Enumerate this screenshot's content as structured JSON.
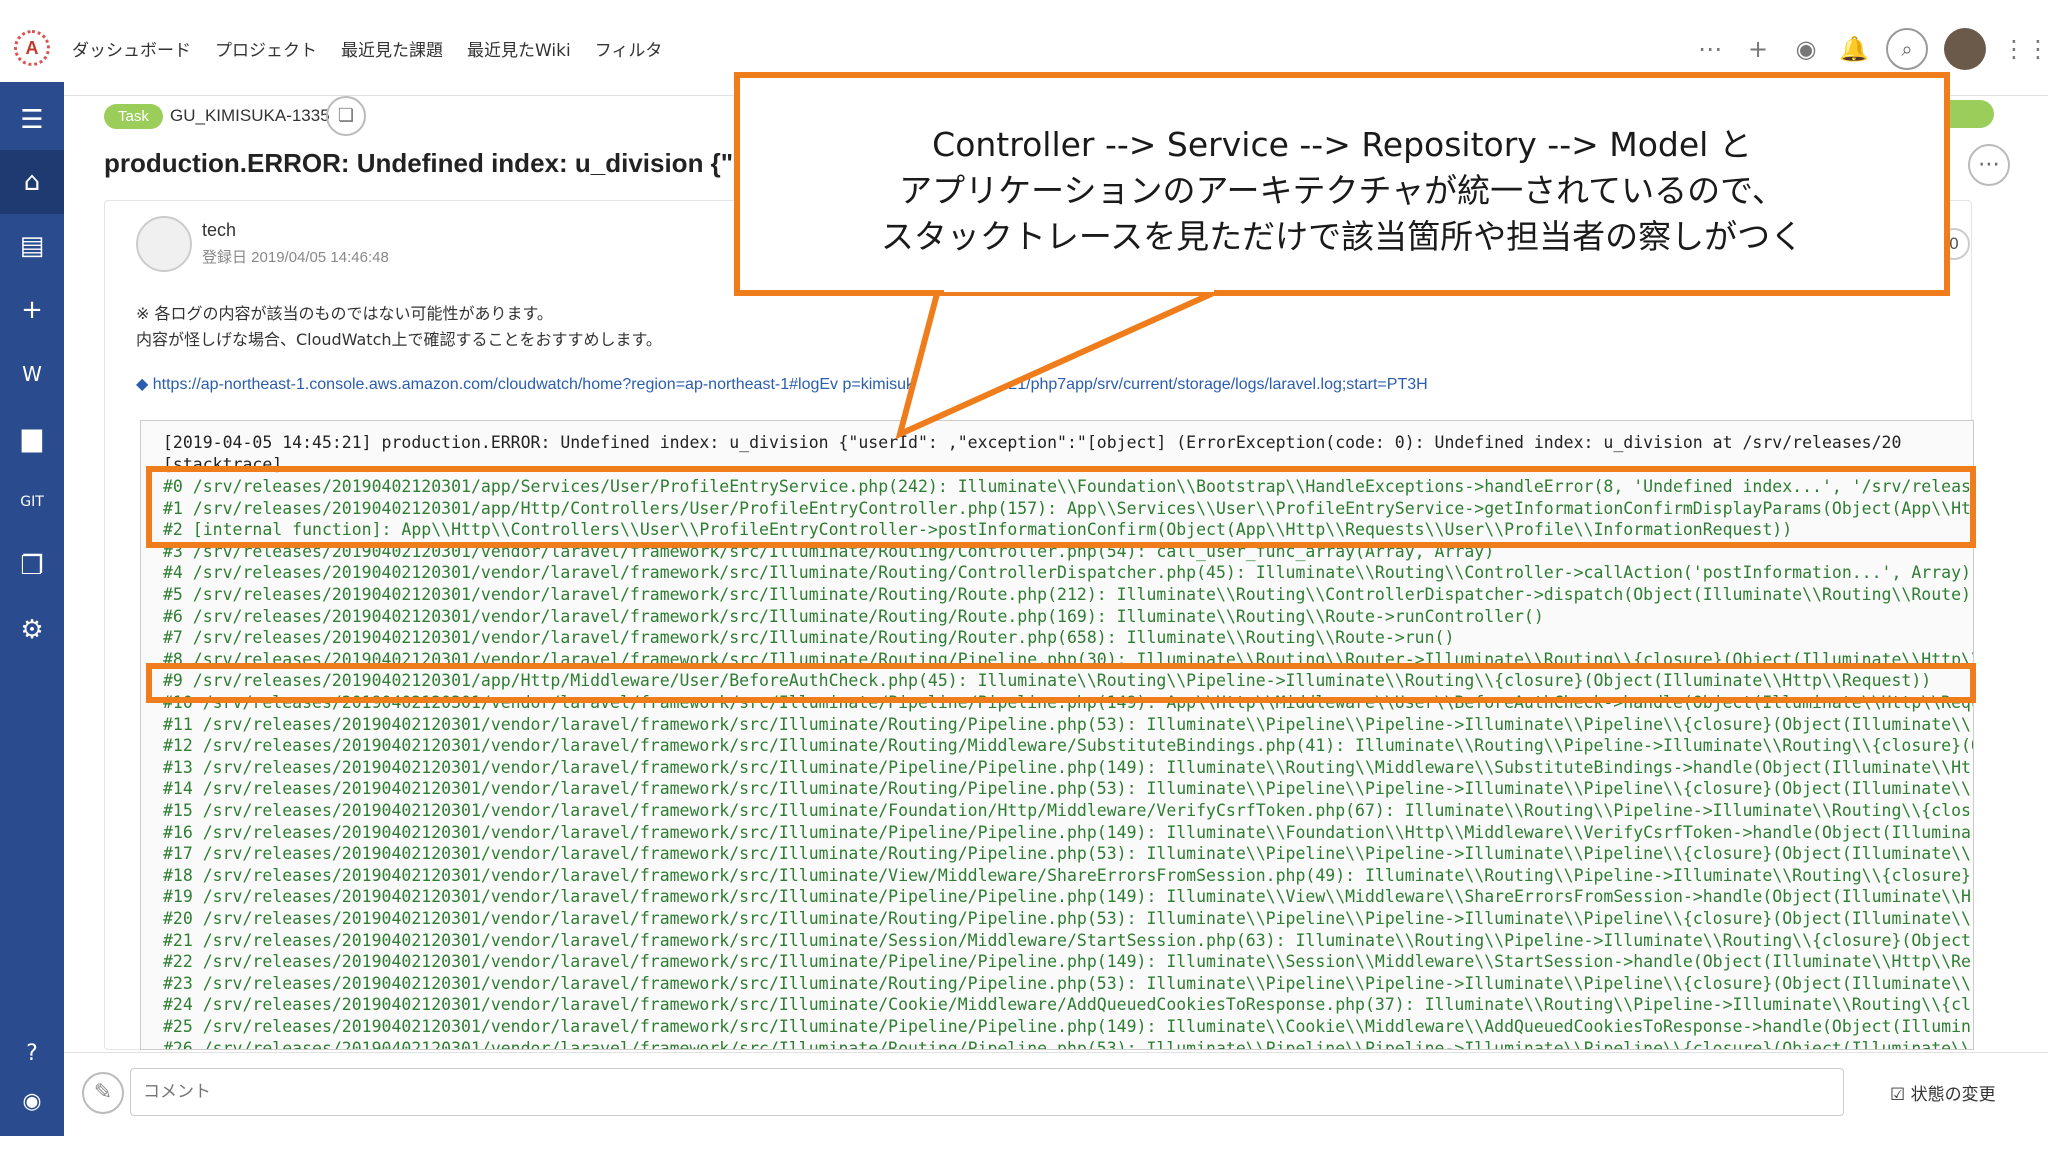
{
  "app": {
    "logo_letter": "A"
  },
  "topnav": {
    "items": [
      "ダッシュボード",
      "プロジェクト",
      "最近見た課題",
      "最近見たWiki",
      "フィルタ"
    ]
  },
  "topicons": {
    "more": "⋯",
    "add": "+",
    "watch": "◉",
    "notify": "🔔",
    "search": "⌕",
    "grid": "⋮⋮"
  },
  "sidebar": {
    "icons": [
      "menu-icon",
      "home-icon",
      "list-icon",
      "add-icon",
      "wiki-icon",
      "files-icon",
      "git-icon",
      "document-icon",
      "settings-icon",
      "help-icon",
      "chat-icon"
    ]
  },
  "task": {
    "badge": "Task",
    "key": "GU_KIMISUKA-1335",
    "title": "production.ERROR: Undefined index: u_division {\"u"
  },
  "author": {
    "name": "tech",
    "date": "登録日 2019/04/05 14:46:48",
    "count": "0"
  },
  "notes": [
    "※ 各ログの内容が該当のものではない可能性があります。",
    "内容が怪しげな場合、CloudWatch上で確認することをおすすめします。"
  ],
  "link": "◆ https://ap-northeast-1.console.aws.amazon.com/cloudwatch/home?region=ap-northeast-1#logEv                              p=kimisuka-production-21/php7app/srv/current/storage/logs/laravel.log;start=PT3H",
  "log": {
    "head": "[2019-04-05 14:45:21] production.ERROR: Undefined index: u_division {\"userId\":         ,\"exception\":\"[object] (ErrorException(code: 0): Undefined index: u_division at /srv/releases/20",
    "stack_label": "[stacktrace]",
    "lines": [
      "#0 /srv/releases/20190402120301/app/Services/User/ProfileEntryService.php(242): Illuminate\\\\Foundation\\\\Bootstrap\\\\HandleExceptions->handleError(8, 'Undefined index...', '/srv/releas",
      "#1 /srv/releases/20190402120301/app/Http/Controllers/User/ProfileEntryController.php(157): App\\\\Services\\\\User\\\\ProfileEntryService->getInformationConfirmDisplayParams(Object(App\\\\Ht",
      "#2 [internal function]: App\\\\Http\\\\Controllers\\\\User\\\\ProfileEntryController->postInformationConfirm(Object(App\\\\Http\\\\Requests\\\\User\\\\Profile\\\\InformationRequest))",
      "#3 /srv/releases/20190402120301/vendor/laravel/framework/src/Illuminate/Routing/Controller.php(54): call_user_func_array(Array, Array)",
      "#4 /srv/releases/20190402120301/vendor/laravel/framework/src/Illuminate/Routing/ControllerDispatcher.php(45): Illuminate\\\\Routing\\\\Controller->callAction('postInformation...', Array)",
      "#5 /srv/releases/20190402120301/vendor/laravel/framework/src/Illuminate/Routing/Route.php(212): Illuminate\\\\Routing\\\\ControllerDispatcher->dispatch(Object(Illuminate\\\\Routing\\\\Route)",
      "#6 /srv/releases/20190402120301/vendor/laravel/framework/src/Illuminate/Routing/Route.php(169): Illuminate\\\\Routing\\\\Route->runController()",
      "#7 /srv/releases/20190402120301/vendor/laravel/framework/src/Illuminate/Routing/Router.php(658): Illuminate\\\\Routing\\\\Route->run()",
      "#8 /srv/releases/20190402120301/vendor/laravel/framework/src/Illuminate/Routing/Pipeline.php(30): Illuminate\\\\Routing\\\\Router->Illuminate\\\\Routing\\\\{closure}(Object(Illuminate\\\\Http\\\\",
      "#9 /srv/releases/20190402120301/app/Http/Middleware/User/BeforeAuthCheck.php(45): Illuminate\\\\Routing\\\\Pipeline->Illuminate\\\\Routing\\\\{closure}(Object(Illuminate\\\\Http\\\\Request))",
      "#10 /srv/releases/20190402120301/vendor/laravel/framework/src/Illuminate/Pipeline/Pipeline.php(149): App\\\\Http\\\\Middleware\\\\User\\\\BeforeAuthCheck->handle(Object(Illuminate\\\\Http\\\\Requ",
      "#11 /srv/releases/20190402120301/vendor/laravel/framework/src/Illuminate/Routing/Pipeline.php(53): Illuminate\\\\Pipeline\\\\Pipeline->Illuminate\\\\Pipeline\\\\{closure}(Object(Illuminate\\\\",
      "#12 /srv/releases/20190402120301/vendor/laravel/framework/src/Illuminate/Routing/Middleware/SubstituteBindings.php(41): Illuminate\\\\Routing\\\\Pipeline->Illuminate\\\\Routing\\\\{closure}(O",
      "#13 /srv/releases/20190402120301/vendor/laravel/framework/src/Illuminate/Pipeline/Pipeline.php(149): Illuminate\\\\Routing\\\\Middleware\\\\SubstituteBindings->handle(Object(Illuminate\\\\Ht",
      "#14 /srv/releases/20190402120301/vendor/laravel/framework/src/Illuminate/Routing/Pipeline.php(53): Illuminate\\\\Pipeline\\\\Pipeline->Illuminate\\\\Pipeline\\\\{closure}(Object(Illuminate\\\\",
      "#15 /srv/releases/20190402120301/vendor/laravel/framework/src/Illuminate/Foundation/Http/Middleware/VerifyCsrfToken.php(67): Illuminate\\\\Routing\\\\Pipeline->Illuminate\\\\Routing\\\\{clos",
      "#16 /srv/releases/20190402120301/vendor/laravel/framework/src/Illuminate/Pipeline/Pipeline.php(149): Illuminate\\\\Foundation\\\\Http\\\\Middleware\\\\VerifyCsrfToken->handle(Object(Illumina",
      "#17 /srv/releases/20190402120301/vendor/laravel/framework/src/Illuminate/Routing/Pipeline.php(53): Illuminate\\\\Pipeline\\\\Pipeline->Illuminate\\\\Pipeline\\\\{closure}(Object(Illuminate\\\\",
      "#18 /srv/releases/20190402120301/vendor/laravel/framework/src/Illuminate/View/Middleware/ShareErrorsFromSession.php(49): Illuminate\\\\Routing\\\\Pipeline->Illuminate\\\\Routing\\\\{closure}",
      "#19 /srv/releases/20190402120301/vendor/laravel/framework/src/Illuminate/Pipeline/Pipeline.php(149): Illuminate\\\\View\\\\Middleware\\\\ShareErrorsFromSession->handle(Object(Illuminate\\\\H",
      "#20 /srv/releases/20190402120301/vendor/laravel/framework/src/Illuminate/Routing/Pipeline.php(53): Illuminate\\\\Pipeline\\\\Pipeline->Illuminate\\\\Pipeline\\\\{closure}(Object(Illuminate\\\\",
      "#21 /srv/releases/20190402120301/vendor/laravel/framework/src/Illuminate/Session/Middleware/StartSession.php(63): Illuminate\\\\Routing\\\\Pipeline->Illuminate\\\\Routing\\\\{closure}(Object",
      "#22 /srv/releases/20190402120301/vendor/laravel/framework/src/Illuminate/Pipeline/Pipeline.php(149): Illuminate\\\\Session\\\\Middleware\\\\StartSession->handle(Object(Illuminate\\\\Http\\\\Re",
      "#23 /srv/releases/20190402120301/vendor/laravel/framework/src/Illuminate/Routing/Pipeline.php(53): Illuminate\\\\Pipeline\\\\Pipeline->Illuminate\\\\Pipeline\\\\{closure}(Object(Illuminate\\\\",
      "#24 /srv/releases/20190402120301/vendor/laravel/framework/src/Illuminate/Cookie/Middleware/AddQueuedCookiesToResponse.php(37): Illuminate\\\\Routing\\\\Pipeline->Illuminate\\\\Routing\\\\{cl",
      "#25 /srv/releases/20190402120301/vendor/laravel/framework/src/Illuminate/Pipeline/Pipeline.php(149): Illuminate\\\\Cookie\\\\Middleware\\\\AddQueuedCookiesToResponse->handle(Object(Illumin",
      "#26 /srv/releases/20190402120301/vendor/laravel/framework/src/Illuminate/Routing/Pipeline.php(53): Illuminate\\\\Pipeline\\\\Pipeline->Illuminate\\\\Pipeline\\\\{closure}(Object(Illuminate\\\\"
    ]
  },
  "callout": {
    "lines": [
      "Controller --> Service --> Repository --> Model と",
      "アプリケーションのアーキテクチャが統一されているので、",
      "スタックトレースを見ただけで該当箇所や担当者の察しがつく"
    ]
  },
  "comment": {
    "placeholder": "コメント",
    "status_change": "状態の変更"
  },
  "colors": {
    "highlight": "#f07d1b",
    "sidebar": "#2a4c8e",
    "log_text": "#2e7d32",
    "task_badge": "#9acd5a"
  }
}
